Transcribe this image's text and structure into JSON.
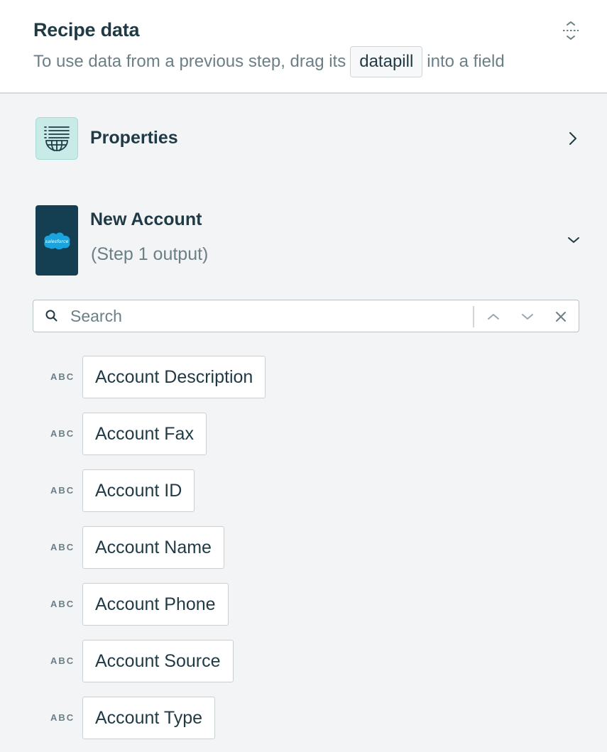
{
  "header": {
    "title": "Recipe data",
    "hint_before": "To use data from a previous step, drag its",
    "hint_chip": "datapill",
    "hint_after": "into a field",
    "collapse_icon": "collapse-vertical-icon"
  },
  "sections": {
    "properties": {
      "title": "Properties",
      "icon": "list-globe-icon",
      "expanded": false
    },
    "new_account": {
      "title": "New Account",
      "subtitle": "(Step 1 output)",
      "icon": "salesforce-logo",
      "logo_text": "salesforce",
      "expanded": true
    }
  },
  "search": {
    "placeholder": "Search",
    "value": ""
  },
  "pills": [
    {
      "type": "ABC",
      "label": "Account Description"
    },
    {
      "type": "ABC",
      "label": "Account Fax"
    },
    {
      "type": "ABC",
      "label": "Account ID"
    },
    {
      "type": "ABC",
      "label": "Account Name"
    },
    {
      "type": "ABC",
      "label": "Account Phone"
    },
    {
      "type": "ABC",
      "label": "Account Source"
    },
    {
      "type": "ABC",
      "label": "Account Type"
    }
  ],
  "colors": {
    "text_primary": "#1f3a45",
    "text_secondary": "#6b7f87",
    "background": "#f3f4f6",
    "salesforce_tile": "#143e52",
    "salesforce_cloud": "#1aa3dd",
    "properties_tile": "#c9ebe8"
  }
}
